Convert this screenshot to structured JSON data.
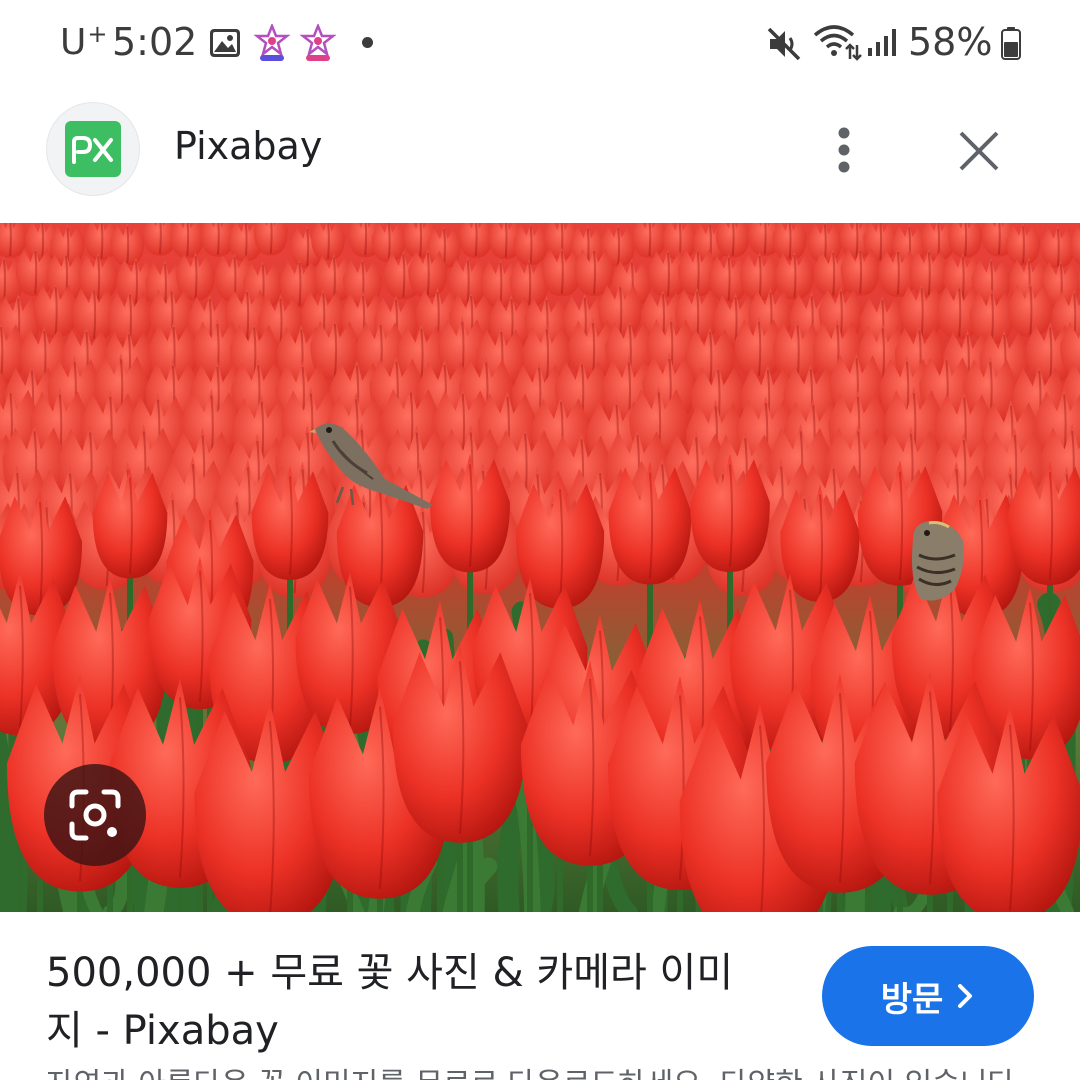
{
  "status_bar": {
    "carrier": "U",
    "carrier_sup": "+",
    "time": "5:02",
    "battery": "58%",
    "icons": [
      "gallery-icon",
      "app-icon",
      "app-icon",
      "notification-dot",
      "mute-icon",
      "wifi-icon",
      "signal-icon",
      "battery-icon"
    ]
  },
  "header": {
    "site_logo_text": "px",
    "site_name": "Pixabay",
    "more_icon": "more-vertical-icon",
    "close_icon": "close-icon"
  },
  "preview": {
    "lens_icon": "google-lens-icon"
  },
  "result": {
    "title": "500,000 + 무료 꽃 사진 & 카메라 이미지 - Pixabay",
    "visit_label": "방문",
    "visit_icon": "chevron-right-icon",
    "snippet": "자연과 아름다운 꽃 이미지를 무료로 다운로드하세요. 다양한 사진이 있습니다."
  },
  "colors": {
    "accent": "#1a73e8",
    "logo_green": "#3dbe63",
    "tulip_red": "#e8322a"
  }
}
